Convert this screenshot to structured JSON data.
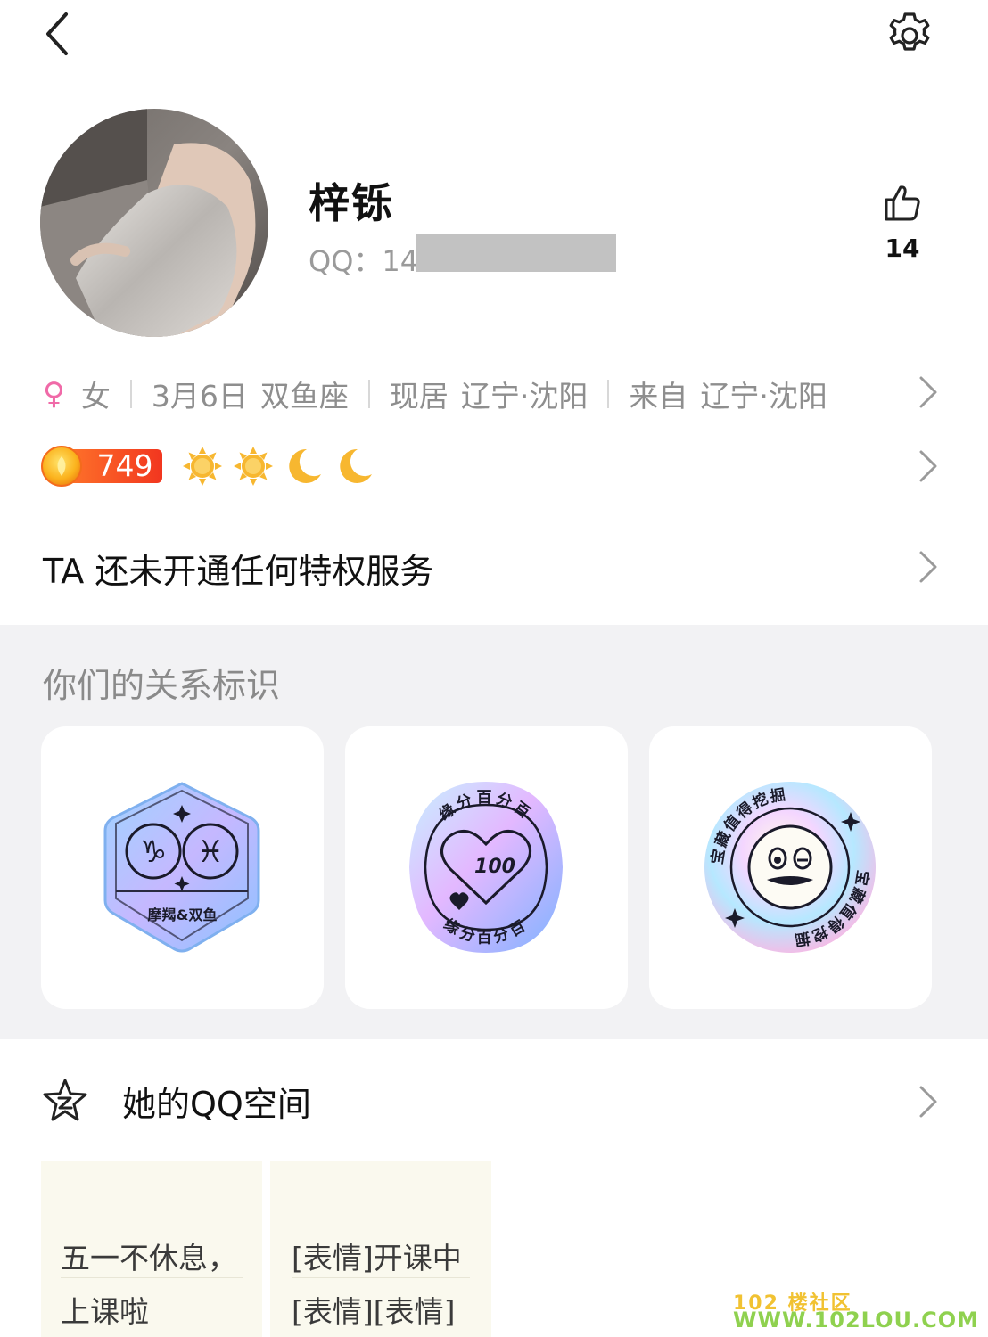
{
  "header": {
    "nickname": "梓铄",
    "qq_prefix": "QQ：",
    "qq_number_visible": "14",
    "likes": "14",
    "icons": {
      "back": "chevron-left-icon",
      "settings": "gear-icon",
      "like": "thumbs-up-icon"
    }
  },
  "info": {
    "gender": "女",
    "birthday": "3月6日",
    "zodiac": "双鱼座",
    "location_label": "现居",
    "location": "辽宁·沈阳",
    "hometown_label": "来自",
    "hometown": "辽宁·沈阳"
  },
  "level": {
    "value": "749",
    "icons": [
      "sun-icon",
      "sun-icon",
      "moon-icon",
      "moon-icon"
    ]
  },
  "privilege": {
    "text": "TA 还未开通任何特权服务"
  },
  "relation": {
    "title": "你们的关系标识",
    "badges": [
      {
        "name": "zodiac-match-badge",
        "label": "摩羯&双鱼"
      },
      {
        "name": "fate-100-badge",
        "label": "缘分百分百"
      },
      {
        "name": "treasure-badge",
        "label": "宝藏值得挖掘"
      }
    ]
  },
  "qzone": {
    "title": "她的QQ空间",
    "posts": [
      {
        "line1": "五一不休息，",
        "line2": "上课啦"
      },
      {
        "line1": "[表情]开课中",
        "line2": "[表情][表情]"
      }
    ]
  },
  "watermark": {
    "line1": "102 楼社区",
    "line2": "WWW.102LOU.COM"
  },
  "colors": {
    "female": "#f06aa8",
    "level_badge": "#f5402a",
    "sun": "#f5a623",
    "section_bg": "#f2f2f4"
  }
}
